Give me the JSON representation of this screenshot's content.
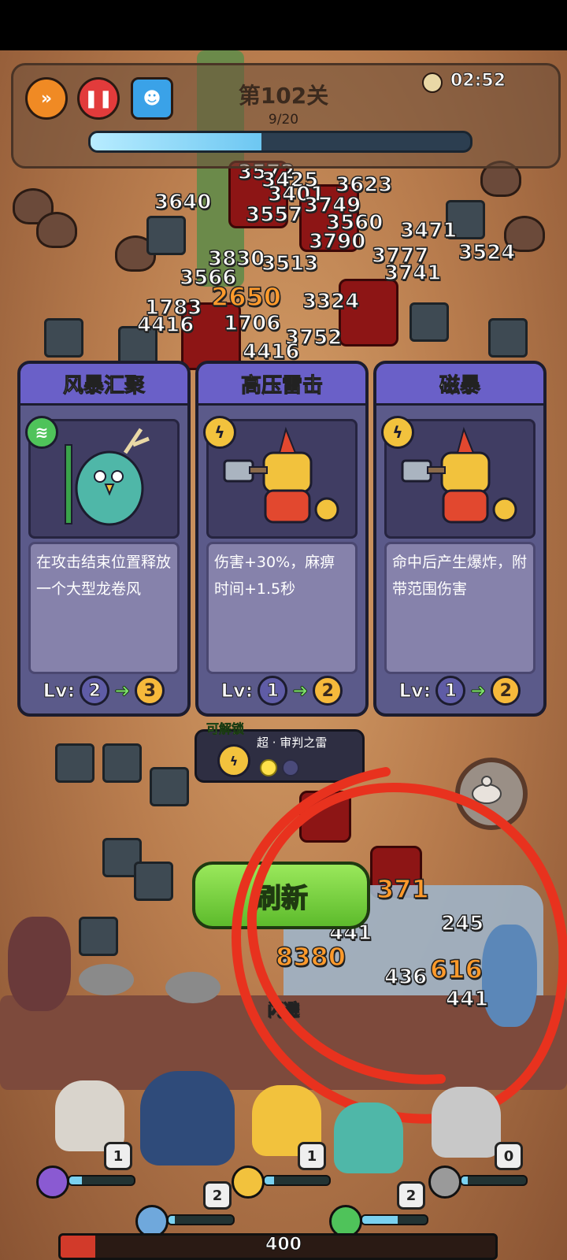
{
  "hud": {
    "level_title": "第102关",
    "wave_progress": "9/20",
    "wave_fraction": 0.45,
    "timer": "02:52",
    "fast_forward_icon": "fast-forward-icon",
    "pause_icon": "pause-icon",
    "codex_icon": "skull-card-icon"
  },
  "cards": [
    {
      "title": "风暴汇聚",
      "badge_icon": "wind-icon",
      "art_icon": "owl-druid-icon",
      "description": "在攻击结束位置释放一个大型龙卷风",
      "lv_label": "Lv:",
      "lv_current": "2",
      "lv_next": "3"
    },
    {
      "title": "高压雷击",
      "badge_icon": "lightning-icon",
      "art_icon": "hammer-warrior-icon",
      "description": "伤害+30%，麻痹时间+1.5秒",
      "lv_label": "Lv:",
      "lv_current": "1",
      "lv_next": "2"
    },
    {
      "title": "磁暴",
      "badge_icon": "lightning-icon",
      "art_icon": "hammer-warrior-icon",
      "description": "命中后产生爆炸，附带范围伤害",
      "lv_label": "Lv:",
      "lv_current": "1",
      "lv_next": "2"
    }
  ],
  "unlock": {
    "label": "可解锁",
    "name": "超 · 审判之雷",
    "icon": "lightning-icon"
  },
  "refresh_label": "刷新",
  "damage_numbers": [
    "3572",
    "3425",
    "3401",
    "3623",
    "3749",
    "3640",
    "3557",
    "3560",
    "3471",
    "3790",
    "3777",
    "3524",
    "3830",
    "3513",
    "3741",
    "3566",
    "2650",
    "3324",
    "1783",
    "4416",
    "1706",
    "3752",
    "4416",
    "371",
    "441",
    "245",
    "8380",
    "616",
    "436",
    "441",
    "闪避"
  ],
  "heroes": [
    {
      "level": "1",
      "icon": "feather-icon"
    },
    {
      "level": "2",
      "icon": "crystal-icon"
    },
    {
      "level": "1",
      "icon": "lightning-icon"
    },
    {
      "level": "2",
      "icon": "wind-icon"
    },
    {
      "level": "0",
      "icon": "claw-icon"
    }
  ],
  "base_hp": "400",
  "colors": {
    "card_header": "#6a60c8",
    "card_body": "#5b5a8a",
    "refresh_green": "#5dbb2c",
    "annotation_red": "#e8321e"
  }
}
